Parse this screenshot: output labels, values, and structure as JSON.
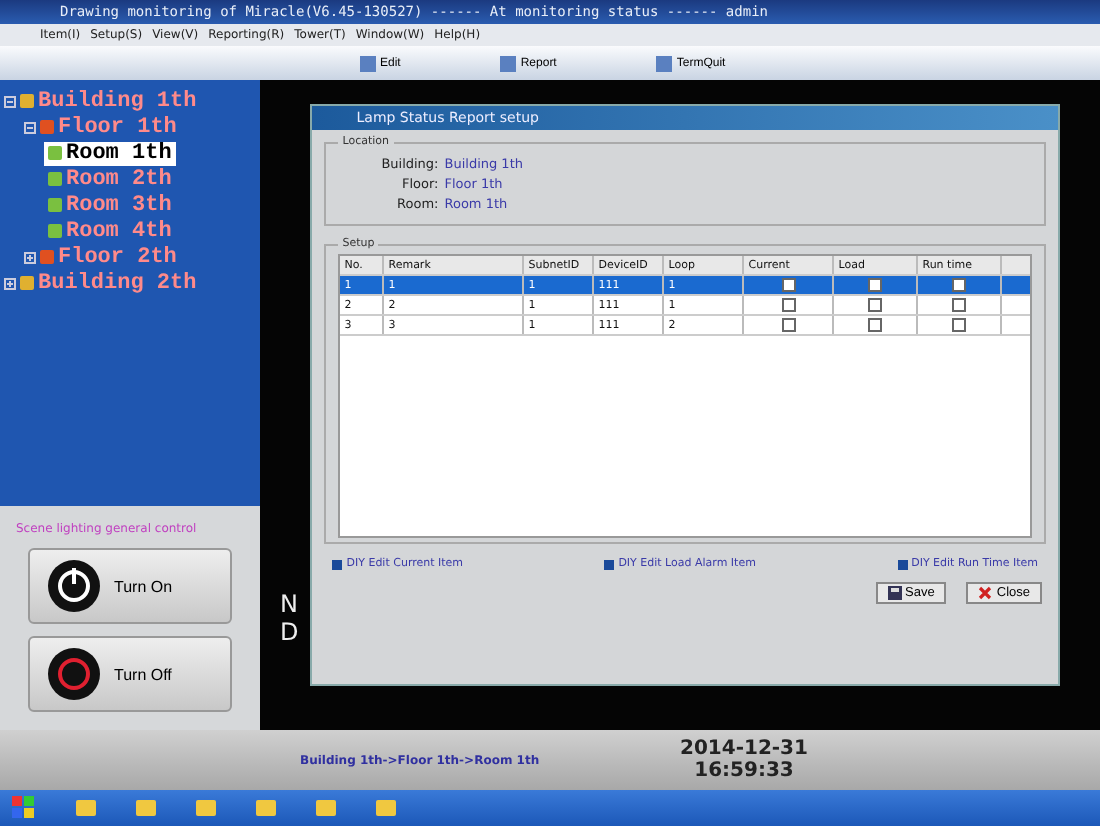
{
  "window": {
    "title": "Drawing monitoring of Miracle(V6.45-130527) ------ At monitoring status ------ admin"
  },
  "menu": [
    "Item(I)",
    "Setup(S)",
    "View(V)",
    "Reporting(R)",
    "Tower(T)",
    "Window(W)",
    "Help(H)"
  ],
  "toolbar": [
    {
      "label": "Edit"
    },
    {
      "label": "Report"
    },
    {
      "label": "TermQuit"
    }
  ],
  "tree": [
    {
      "label": "Building 1th",
      "kind": "building",
      "selected": false,
      "expanded": true,
      "children": [
        {
          "label": "Floor 1th",
          "kind": "floor",
          "selected": false,
          "expanded": true,
          "children": [
            {
              "label": "Room 1th",
              "kind": "room",
              "selected": true
            },
            {
              "label": "Room 2th",
              "kind": "room",
              "selected": false
            },
            {
              "label": "Room 3th",
              "kind": "room",
              "selected": false
            },
            {
              "label": "Room 4th",
              "kind": "room",
              "selected": false
            }
          ]
        },
        {
          "label": "Floor 2th",
          "kind": "floor",
          "selected": false,
          "expanded": false
        }
      ]
    },
    {
      "label": "Building 2th",
      "kind": "building",
      "selected": false,
      "expanded": false
    }
  ],
  "control": {
    "title": "Scene lighting general control",
    "buttons": [
      {
        "label": "Turn On",
        "kind": "on"
      },
      {
        "label": "Turn Off",
        "kind": "off"
      }
    ]
  },
  "side_letters": [
    "N",
    "D"
  ],
  "dialog": {
    "title": "Lamp Status Report setup",
    "location": {
      "legend": "Location",
      "fields": [
        {
          "label": "Building:",
          "value": "Building 1th"
        },
        {
          "label": "Floor:",
          "value": "Floor 1th"
        },
        {
          "label": "Room:",
          "value": "Room 1th"
        }
      ]
    },
    "setup": {
      "legend": "Setup",
      "columns": [
        "No.",
        "Remark",
        "SubnetID",
        "DeviceID",
        "Loop",
        "Current",
        "Load",
        "Run time"
      ],
      "rows": [
        {
          "cells": [
            "1",
            "1",
            "1",
            "111",
            "1"
          ],
          "selected": true,
          "checks": [
            false,
            false,
            false
          ]
        },
        {
          "cells": [
            "2",
            "2",
            "1",
            "111",
            "1"
          ],
          "selected": false,
          "checks": [
            false,
            false,
            false
          ]
        },
        {
          "cells": [
            "3",
            "3",
            "1",
            "111",
            "2"
          ],
          "selected": false,
          "checks": [
            false,
            false,
            false
          ]
        }
      ]
    },
    "links": [
      "DIY Edit Current Item",
      "DIY Edit Load Alarm Item",
      "DIY Edit Run Time Item"
    ],
    "buttons": [
      {
        "label": "Save",
        "kind": "save"
      },
      {
        "label": "Close",
        "kind": "close"
      }
    ]
  },
  "status": {
    "path": "Building 1th->Floor 1th->Room 1th",
    "date": "2014-12-31",
    "time": "16:59:33"
  }
}
